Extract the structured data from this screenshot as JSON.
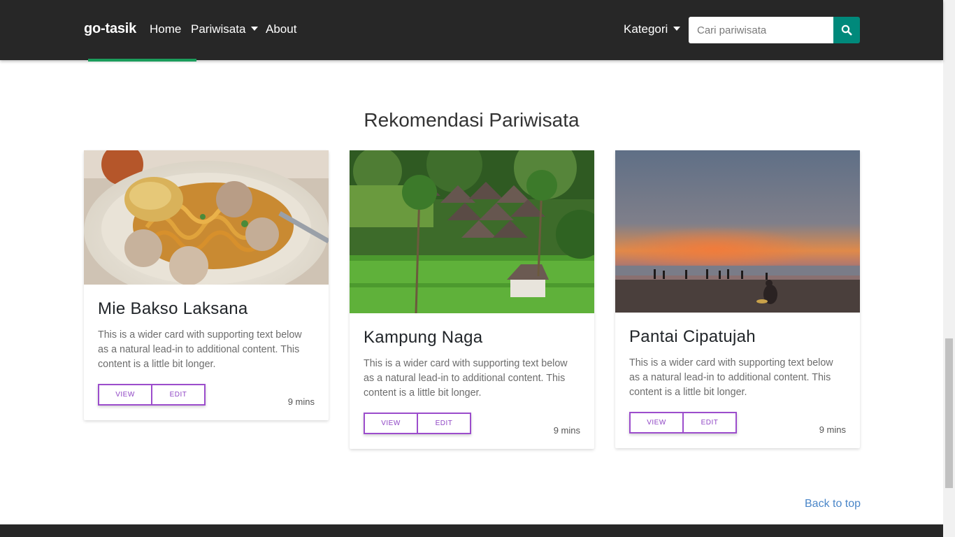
{
  "navbar": {
    "brand": "go-tasik",
    "links": {
      "home": "Home",
      "pariwisata": "Pariwisata",
      "about": "About",
      "kategori": "Kategori"
    },
    "search_placeholder": "Cari pariwisata",
    "accent_color": "#00897b"
  },
  "section": {
    "title": "Rekomendasi Pariwisata"
  },
  "cards": [
    {
      "title": "Mie Bakso Laksana",
      "text": "This is a wider card with supporting text below as a natural lead-in to additional content. This content is a little bit longer.",
      "view_label": "VIEW",
      "edit_label": "EDIT",
      "time": "9 mins"
    },
    {
      "title": "Kampung Naga",
      "text": "This is a wider card with supporting text below as a natural lead-in to additional content. This content is a little bit longer.",
      "view_label": "VIEW",
      "edit_label": "EDIT",
      "time": "9 mins"
    },
    {
      "title": "Pantai Cipatujah",
      "text": "This is a wider card with supporting text below as a natural lead-in to additional content. This content is a little bit longer.",
      "view_label": "VIEW",
      "edit_label": "EDIT",
      "time": "9 mins"
    }
  ],
  "footer": {
    "back_to_top": "Back to top"
  },
  "colors": {
    "button_border": "#9c4dcc",
    "navbar_bg": "#272727",
    "link": "#4a86c8"
  }
}
